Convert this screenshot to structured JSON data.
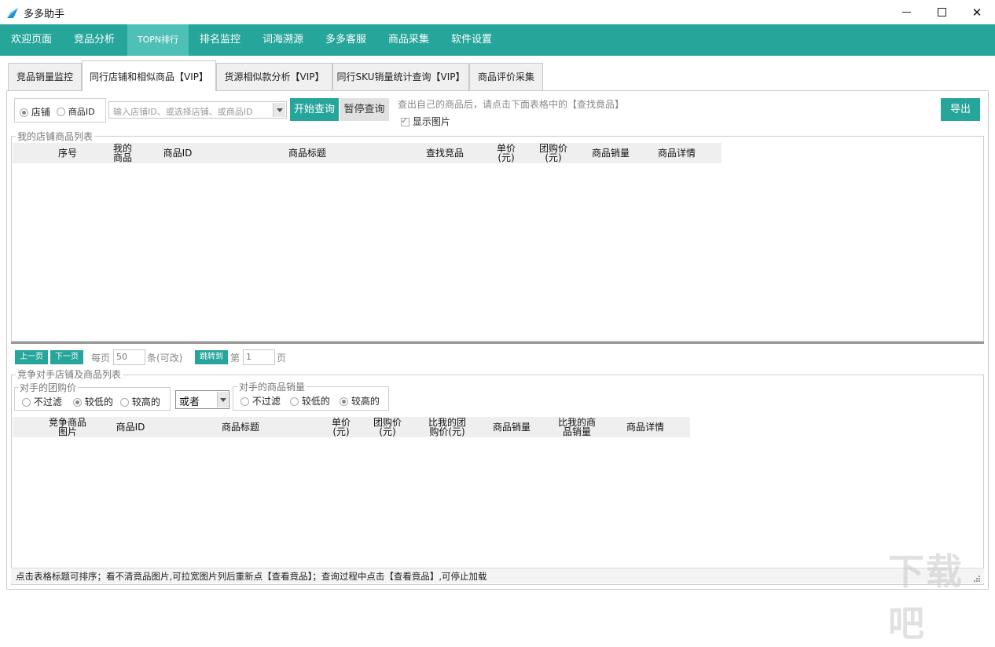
{
  "window": {
    "title": "多多助手",
    "minimize": "—",
    "maximize": "☐",
    "close": "✕"
  },
  "nav": {
    "items": [
      "欢迎页面",
      "竞品分析",
      "TOPN排行",
      "排名监控",
      "词海溯源",
      "多多客服",
      "商品采集",
      "软件设置"
    ],
    "active": 2
  },
  "tabs": {
    "items": [
      "竞品销量监控",
      "同行店铺和相似商品【VIP】",
      "货源相似款分析【VIP】",
      "同行SKU销量统计查询【VIP】",
      "商品评价采集"
    ],
    "active": 1
  },
  "search": {
    "radio_shop": "店铺",
    "radio_id": "商品ID",
    "placeholder": "输入店铺ID、或选择店铺、或商品ID",
    "start_btn": "开始查询",
    "pause_btn": "暂停查询",
    "hint": "查出自己的商品后，请点击下面表格中的【查找竟品】",
    "show_images": "显示图片",
    "export_btn": "导出"
  },
  "my_list": {
    "title": "我的店铺商品列表",
    "columns": [
      "序号",
      "我的\n商品",
      "商品ID",
      "商品标题",
      "查找竞品",
      "单价\n(元)",
      "团购价\n(元)",
      "商品销量",
      "商品详情"
    ]
  },
  "pager": {
    "prev": "上一页",
    "next": "下一页",
    "per_page_label": "每页",
    "per_page_value": "50",
    "per_page_suffix": "条(可改)",
    "jump_btn": "跳转到",
    "page_prefix": "第",
    "page_value": "1",
    "page_suffix": "页"
  },
  "competitor": {
    "title": "竞争对手店铺及商品列表",
    "price_group": {
      "label": "对手的团购价",
      "options": [
        "不过滤",
        "较低的",
        "较高的"
      ],
      "selected": 1
    },
    "logic_select": "或者",
    "sales_group": {
      "label": "对手的商品销量",
      "options": [
        "不过滤",
        "较低的",
        "较高的"
      ],
      "selected": 2
    },
    "columns": [
      "竞争商品\n图片",
      "商品ID",
      "商品标题",
      "单价\n(元)",
      "团购价\n(元)",
      "比我的团\n购价(元)",
      "商品销量",
      "比我的商\n品销量",
      "商品详情"
    ]
  },
  "status": {
    "text": "点击表格标题可排序；看不清竟品图片,可拉宽图片列后重新点【查看竟品】；查询过程中点击【查看竟品】,可停止加载"
  },
  "watermark": "下载吧",
  "colors": {
    "accent": "#26a59a",
    "accent_light": "#4fc0b6"
  }
}
